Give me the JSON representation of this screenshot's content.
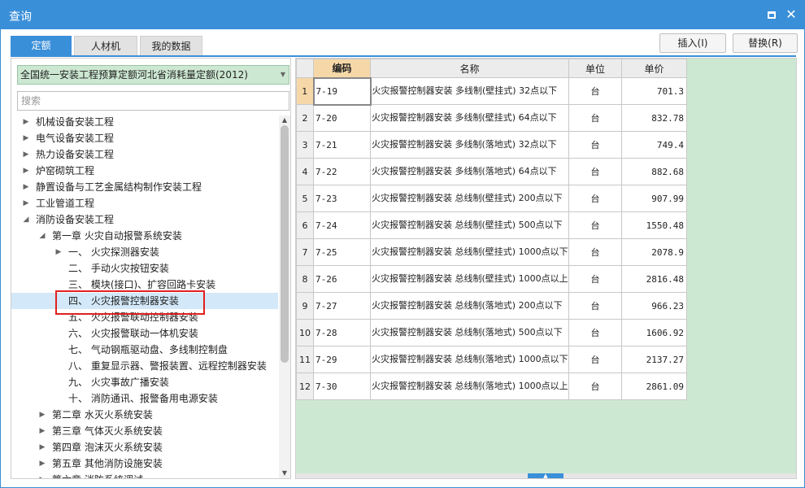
{
  "window": {
    "title": "查询",
    "maximize_icon": "maximize-icon",
    "close_icon": "close-icon",
    "close_glyph": "✕"
  },
  "tabs": [
    {
      "label": "定额",
      "active": true
    },
    {
      "label": "人材机",
      "active": false
    },
    {
      "label": "我的数据",
      "active": false
    }
  ],
  "toolbar": {
    "insert_label": "插入(I)",
    "replace_label": "替换(R)"
  },
  "left": {
    "select_value": "全国统一安装工程预算定额河北省消耗量定额(2012)",
    "search_placeholder": "搜索",
    "tree": [
      {
        "level": 0,
        "exp": "▶",
        "label": "机械设备安装工程"
      },
      {
        "level": 0,
        "exp": "▶",
        "label": "电气设备安装工程"
      },
      {
        "level": 0,
        "exp": "▶",
        "label": "热力设备安装工程"
      },
      {
        "level": 0,
        "exp": "▶",
        "label": "炉窑砌筑工程"
      },
      {
        "level": 0,
        "exp": "▶",
        "label": "静置设备与工艺金属结构制作安装工程"
      },
      {
        "level": 0,
        "exp": "▶",
        "label": "工业管道工程"
      },
      {
        "level": 0,
        "exp": "◢",
        "label": "消防设备安装工程"
      },
      {
        "level": 1,
        "exp": "◢",
        "label": "第一章 火灾自动报警系统安装"
      },
      {
        "level": 2,
        "exp": "▶",
        "label": "一、 火灾探测器安装"
      },
      {
        "level": 2,
        "exp": "",
        "label": "二、 手动火灾按钮安装"
      },
      {
        "level": 2,
        "exp": "",
        "label": "三、 模块(接口)、扩容回路卡安装"
      },
      {
        "level": 2,
        "exp": "",
        "label": "四、 火灾报警控制器安装",
        "selected": true
      },
      {
        "level": 2,
        "exp": "",
        "label": "五、 火灾报警联动控制器安装"
      },
      {
        "level": 2,
        "exp": "",
        "label": "六、 火灾报警联动一体机安装"
      },
      {
        "level": 2,
        "exp": "",
        "label": "七、 气动钢瓶驱动盘、多线制控制盘"
      },
      {
        "level": 2,
        "exp": "",
        "label": "八、 重复显示器、警报装置、远程控制器安装"
      },
      {
        "level": 2,
        "exp": "",
        "label": "九、 火灾事故广播安装"
      },
      {
        "level": 2,
        "exp": "",
        "label": "十、 消防通讯、报警备用电源安装"
      },
      {
        "level": 1,
        "exp": "▶",
        "label": "第二章 水灭火系统安装"
      },
      {
        "level": 1,
        "exp": "▶",
        "label": "第三章 气体灭火系统安装"
      },
      {
        "level": 1,
        "exp": "▶",
        "label": "第四章 泡沫灭火系统安装"
      },
      {
        "level": 1,
        "exp": "▶",
        "label": "第五章 其他消防设施安装"
      },
      {
        "level": 1,
        "exp": "▶",
        "label": "第六章 消防系统调试"
      }
    ]
  },
  "table": {
    "columns": [
      "编码",
      "名称",
      "单位",
      "单价"
    ],
    "rows": [
      {
        "idx": "1",
        "code": "7-19",
        "name": "火灾报警控制器安装 多线制(壁挂式) 32点以下",
        "unit": "台",
        "price": "701.3"
      },
      {
        "idx": "2",
        "code": "7-20",
        "name": "火灾报警控制器安装 多线制(壁挂式) 64点以下",
        "unit": "台",
        "price": "832.78"
      },
      {
        "idx": "3",
        "code": "7-21",
        "name": "火灾报警控制器安装 多线制(落地式) 32点以下",
        "unit": "台",
        "price": "749.4"
      },
      {
        "idx": "4",
        "code": "7-22",
        "name": "火灾报警控制器安装 多线制(落地式) 64点以下",
        "unit": "台",
        "price": "882.68"
      },
      {
        "idx": "5",
        "code": "7-23",
        "name": "火灾报警控制器安装 总线制(壁挂式) 200点以下",
        "unit": "台",
        "price": "907.99"
      },
      {
        "idx": "6",
        "code": "7-24",
        "name": "火灾报警控制器安装 总线制(壁挂式) 500点以下",
        "unit": "台",
        "price": "1550.48"
      },
      {
        "idx": "7",
        "code": "7-25",
        "name": "火灾报警控制器安装 总线制(壁挂式) 1000点以下",
        "unit": "台",
        "price": "2078.9"
      },
      {
        "idx": "8",
        "code": "7-26",
        "name": "火灾报警控制器安装 总线制(壁挂式) 1000点以上",
        "unit": "台",
        "price": "2816.48"
      },
      {
        "idx": "9",
        "code": "7-27",
        "name": "火灾报警控制器安装 总线制(落地式) 200点以下",
        "unit": "台",
        "price": "966.23"
      },
      {
        "idx": "10",
        "code": "7-28",
        "name": "火灾报警控制器安装 总线制(落地式) 500点以下",
        "unit": "台",
        "price": "1606.92"
      },
      {
        "idx": "11",
        "code": "7-29",
        "name": "火灾报警控制器安装 总线制(落地式) 1000点以下",
        "unit": "台",
        "price": "2137.27"
      },
      {
        "idx": "12",
        "code": "7-30",
        "name": "火灾报警控制器安装 总线制(落地式) 1000点以上",
        "unit": "台",
        "price": "2861.09"
      }
    ]
  },
  "colors": {
    "accent": "#3a8fd9",
    "highlight": "#e02020",
    "green_bg": "#cde8d2",
    "header_orange": "#f6d8a8"
  }
}
